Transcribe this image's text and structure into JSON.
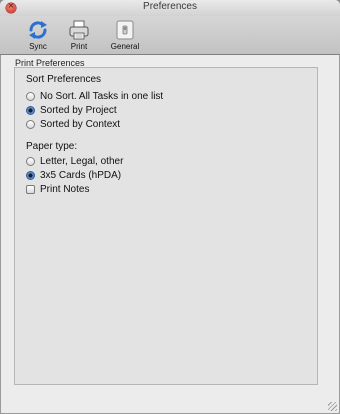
{
  "window": {
    "title": "Preferences"
  },
  "toolbar": {
    "items": [
      {
        "label": "Sync",
        "icon": "sync-icon"
      },
      {
        "label": "Print",
        "icon": "printer-icon"
      },
      {
        "label": "General",
        "icon": "general-switch-icon"
      }
    ]
  },
  "section": {
    "label": "Print Preferences"
  },
  "sort": {
    "label": "Sort Preferences",
    "options": [
      {
        "label": "No Sort. All Tasks in one list",
        "selected": false
      },
      {
        "label": "Sorted by Project",
        "selected": true
      },
      {
        "label": "Sorted by Context",
        "selected": false
      }
    ]
  },
  "paper": {
    "label": "Paper type:",
    "options": [
      {
        "label": "Letter, Legal, other",
        "selected": false
      },
      {
        "label": "3x5 Cards (hPDA)",
        "selected": true
      }
    ]
  },
  "print_notes": {
    "label": "Print Notes",
    "checked": false
  },
  "colors": {
    "accent": "#2966c7",
    "close_button": "#c8281b",
    "sync_icon": "#2b6fd0"
  }
}
